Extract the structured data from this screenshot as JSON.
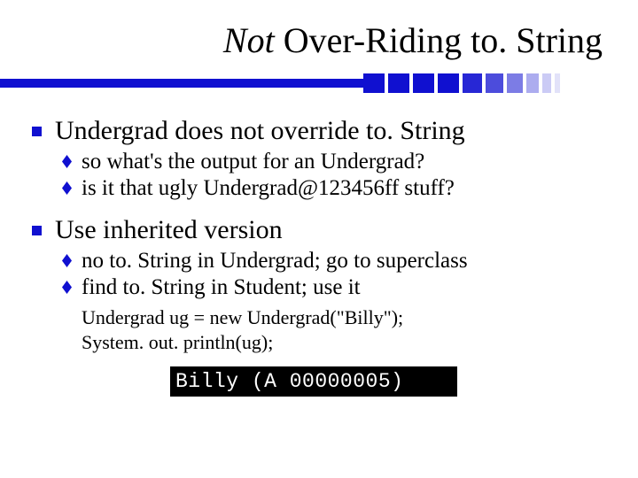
{
  "title": {
    "italic": "Not",
    "rest": " Over-Riding to. String"
  },
  "bullets": {
    "b1": "Undergrad does not override to. String",
    "b1s1": "so what's the output for an Undergrad?",
    "b1s2": "is it that ugly Undergrad@123456ff stuff?",
    "b2": "Use inherited version",
    "b2s1": "no to. String in Undergrad; go to superclass",
    "b2s2": "find to. String in Student; use it"
  },
  "code": {
    "l1": "Undergrad ug = new Undergrad(\"Billy\");",
    "l2": "System. out. println(ug);"
  },
  "output": "Billy (A 00000005)"
}
